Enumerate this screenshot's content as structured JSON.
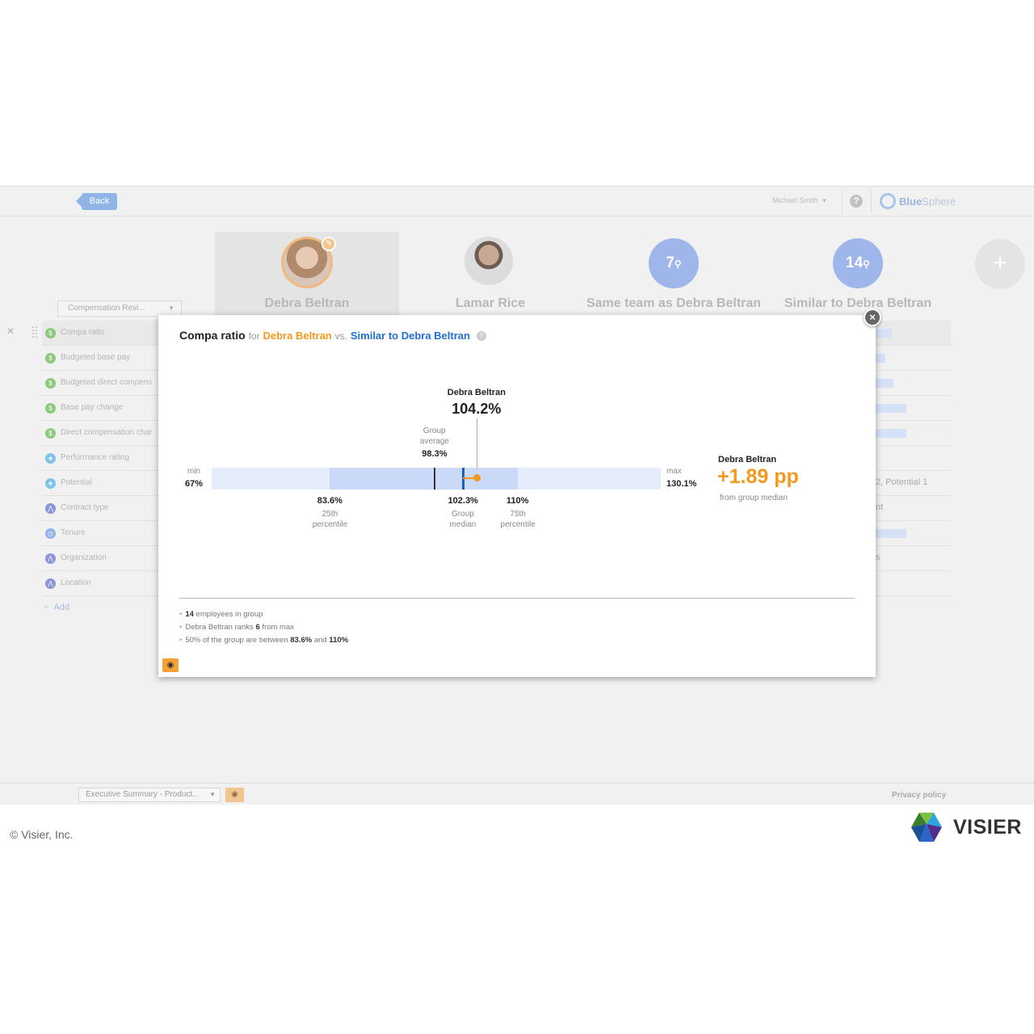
{
  "topbar": {
    "back_label": "Back",
    "user_name": "Michael Smith",
    "help_label": "?",
    "brand_blue": "Blue",
    "brand_sphere": "Sphere"
  },
  "profiles": [
    {
      "name": "Debra Beltran"
    },
    {
      "name": "Lamar Rice"
    },
    {
      "name": "Same team as Debra Beltran",
      "count": "7"
    },
    {
      "name": "Similar to Debra Beltran",
      "count": "14"
    }
  ],
  "add_profile_label": "+",
  "compensation_select": "Compensation Revi...",
  "metrics": [
    {
      "label": "Compa ratio",
      "icon_color": "#8cc97a"
    },
    {
      "label": "Budgeted base pay",
      "icon_color": "#8cc97a"
    },
    {
      "label": "Budgeted direct compens",
      "icon_color": "#8cc97a"
    },
    {
      "label": "Base pay change",
      "icon_color": "#8cc97a"
    },
    {
      "label": "Direct compensation char",
      "icon_color": "#8cc97a"
    },
    {
      "label": "Performance rating",
      "icon_color": "#7fc4e8"
    },
    {
      "label": "Potential",
      "icon_color": "#7fc4e8"
    },
    {
      "label": "Contract type",
      "icon_color": "#8a94d6"
    },
    {
      "label": "Tenure",
      "icon_color": "#8fb1e8"
    },
    {
      "label": "Organization",
      "icon_color": "#8a94d6"
    },
    {
      "label": "Location",
      "icon_color": "#8a94d6"
    }
  ],
  "metric_fragments": {
    "potential": "2, Potential 1",
    "contract": "nt",
    "org": "s"
  },
  "add_label": "Add",
  "footer": {
    "dashboard_select": "Executive Summary - Product...",
    "privacy": "Privacy policy"
  },
  "copyright": "© Visier, Inc.",
  "visier_brand": "VISIER",
  "modal": {
    "title": "Compa ratio",
    "for_word": "for",
    "employee": "Debra Beltran",
    "vs_word": "vs.",
    "group": "Similar to Debra Beltran",
    "help": "?",
    "close": "×",
    "emp_name": "Debra Beltran",
    "emp_value": "104.2%",
    "avg_label_1": "Group",
    "avg_label_2": "average",
    "avg_value": "98.3%",
    "min_label": "min",
    "min_value": "67%",
    "max_label": "max",
    "max_value": "130.1%",
    "p25_value": "83.6%",
    "p25_label_1": "25th",
    "p25_label_2": "percentile",
    "median_value": "102.3%",
    "median_label_1": "Group",
    "median_label_2": "median",
    "p75_value": "110%",
    "p75_label_1": "75th",
    "p75_label_2": "percentile",
    "delta_name": "Debra Beltran",
    "delta_value": "+1.89 pp",
    "delta_caption": "from group median",
    "notes": {
      "n1_count": "14",
      "n1_text": "employees in group",
      "n2_pre": "Debra Beltran ranks",
      "n2_rank": "6",
      "n2_post": "from max",
      "n3_pre": "50% of the group are between",
      "n3_low": "83.6%",
      "n3_and": "and",
      "n3_high": "110%"
    },
    "chart_data": {
      "type": "bar",
      "min": 67,
      "max": 130.1,
      "p25": 83.6,
      "median": 102.3,
      "p75": 110,
      "group_average": 98.3,
      "employee_value": 104.2
    }
  },
  "colors": {
    "accent_orange": "#f39a1e",
    "accent_blue": "#1f6fd0"
  }
}
